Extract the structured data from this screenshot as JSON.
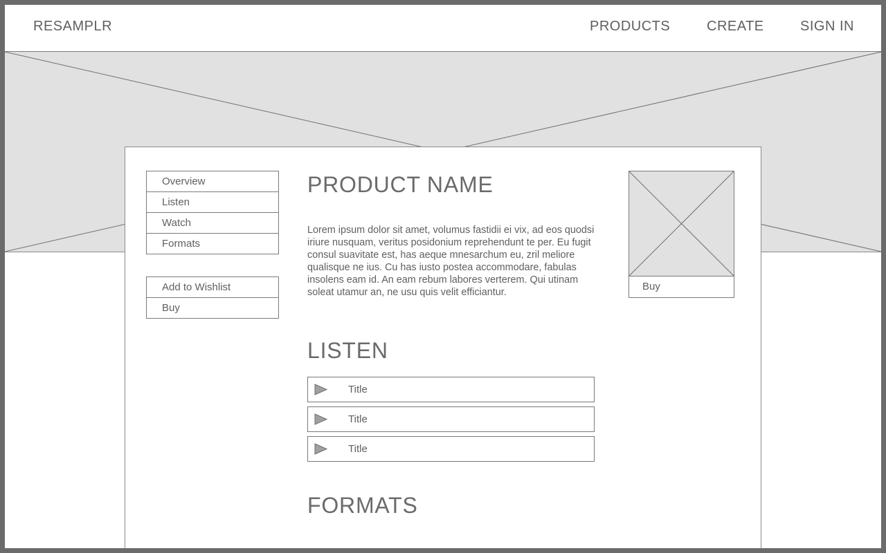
{
  "header": {
    "brand": "RESAMPLR",
    "nav": [
      "PRODUCTS",
      "CREATE",
      "SIGN IN"
    ]
  },
  "sidebar": {
    "sections": [
      "Overview",
      "Listen",
      "Watch",
      "Formats"
    ],
    "actions": [
      "Add to Wishlist",
      "Buy"
    ]
  },
  "product": {
    "name": "PRODUCT NAME",
    "description": "Lorem ipsum dolor sit amet, volumus fastidii ei vix, ad eos quodsi iriure nusquam, veritus posidonium reprehendunt te per. Eu fugit consul suavitate est, has aeque mnesarchum eu, zril meliore qualisque ne ius. Cu has iusto postea accommodare, fabulas insolens eam id. An eam rebum labores verterem. Qui utinam soleat utamur an, ne usu quis velit efficiantur."
  },
  "listen": {
    "heading": "LISTEN",
    "tracks": [
      {
        "title": "Title",
        "icon": "play-icon"
      },
      {
        "title": "Title",
        "icon": "play-icon"
      },
      {
        "title": "Title",
        "icon": "play-icon"
      }
    ]
  },
  "formats": {
    "heading": "FORMATS"
  },
  "buy_box": {
    "buy_label": "Buy",
    "image_icon": "image-placeholder-icon"
  },
  "colors": {
    "frame": "#6b6b6b",
    "placeholder": "#e1e1e1",
    "text": "#5f5f5f",
    "border": "#7a7a7a"
  }
}
